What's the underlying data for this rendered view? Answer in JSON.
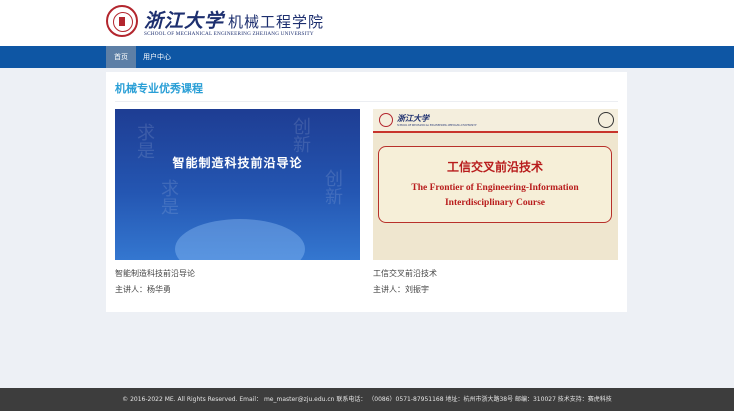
{
  "header": {
    "logo_seal_text": "浙江大学",
    "university": "浙江大学",
    "department": "机械工程学院",
    "english_name": "SCHOOL OF MECHANICAL ENGINEERING ZHEJIANG UNIVERSITY"
  },
  "nav": {
    "items": [
      {
        "label": "首页",
        "active": true
      },
      {
        "label": "用户中心",
        "active": false
      }
    ]
  },
  "section": {
    "title": "机械专业优秀课程"
  },
  "courses": [
    {
      "thumbnail": {
        "title": "智能制造科技前沿导论",
        "background_calligraphy": [
          "求是",
          "创新"
        ]
      },
      "title": "智能制造科技前沿导论",
      "lecturer": "主讲人：杨华勇"
    },
    {
      "thumbnail": {
        "header_cn": "浙江大学",
        "header_en": "SCHOOL OF MECHANICAL ENGINEERING ZHEJIANG UNIVERSITY",
        "title_cn": "工信交叉前沿技术",
        "title_en_line1": "The Frontier of Engineering-Information",
        "title_en_line2": "Interdisciplinary Course"
      },
      "title": "工信交叉前沿技术",
      "lecturer": "主讲人：刘振宇"
    }
  ],
  "footer": {
    "text": "© 2016-2022 ME. All Rights Reserved. Email： me_master@zju.edu.cn 联系电话： （0086）0571-87951168 地址：杭州市浙大路38号 邮编：310027 技术支持：赛虎科技"
  },
  "colors": {
    "nav_bar": "#0e56a4",
    "nav_active": "#5d7fa6",
    "section_title": "#2a9fd6",
    "footer_bg": "#3d3d3d",
    "page_bg": "#edf0f5",
    "brand_navy": "#1d2f6f",
    "brand_red": "#b3262e"
  }
}
